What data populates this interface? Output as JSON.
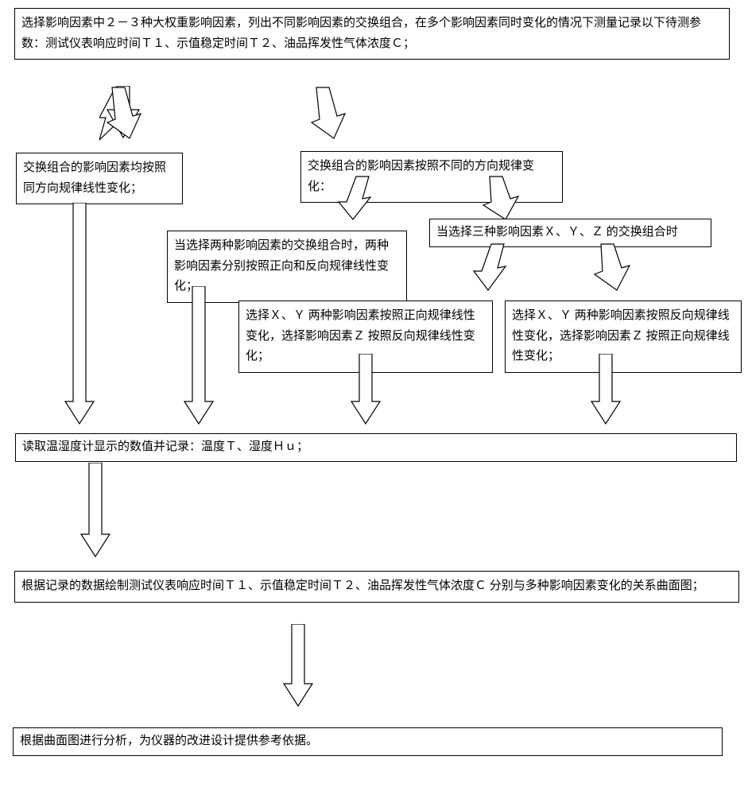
{
  "boxes": {
    "b1": "选择影响因素中２－３种大权重影响因素，列出不同影响因素的交换组合，在多个影响因素同时变化的情况下测量记录以下待测参数：测试仪表响应时间Ｔ１、示值稳定时间Ｔ２、油品挥发性气体浓度Ｃ；",
    "b2": "交换组合的影响因素均按照同方向规律线性变化；",
    "b3": "交换组合的影响因素按照不同的方向规律变化：",
    "b4": "当选择两种影响因素的交换组合时，两种影响因素分别按照正向和反向规律线性变化；",
    "b5": "当选择三种影响因素Ｘ、Ｙ、Ｚ 的交换组合时",
    "b6": "选择Ｘ、Ｙ 两种影响因素按照正向规律线性变化，选择影响因素Ｚ 按照反向规律线性变化；",
    "b7": "选择Ｘ、Ｙ 两种影响因素按照反向规律线性变化，选择影响因素Ｚ 按照正向规律线性变化；",
    "b8": "读取温湿度计显示的数值并记录：温度Ｔ、湿度Ｈｕ；",
    "b9": "根据记录的数据绘制测试仪表响应时间Ｔ１、示值稳定时间Ｔ２、油品挥发性气体浓度Ｃ 分别与多种影响因素变化的关系曲面图；",
    "b10": "根据曲面图进行分析，为仪器的改进设计提供参考依据。"
  }
}
